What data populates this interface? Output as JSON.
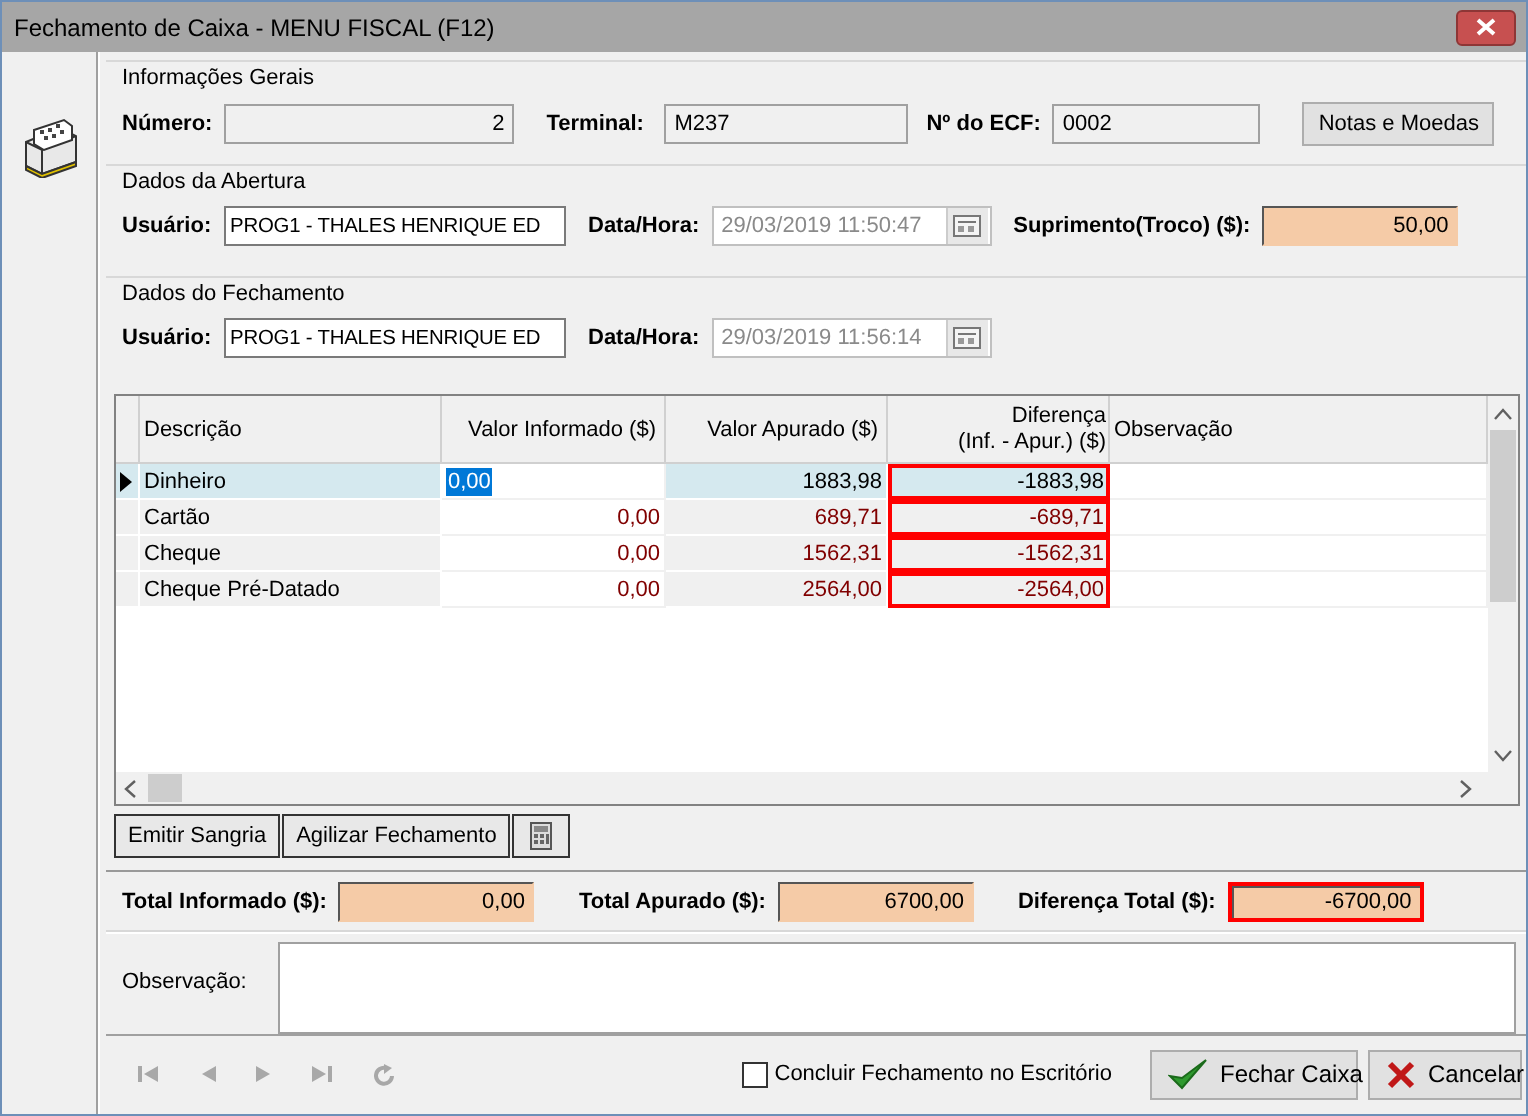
{
  "window": {
    "title": "Fechamento de Caixa - MENU FISCAL (F12)"
  },
  "general": {
    "legend": "Informações Gerais",
    "fields": [
      {
        "label": "Número:",
        "value": "2",
        "kind": "number"
      },
      {
        "label": "Terminal:",
        "value": "M237",
        "kind": "text"
      },
      {
        "label": "Nº do ECF:",
        "value": "0002",
        "kind": "text"
      }
    ],
    "button": "Notas e Moedas"
  },
  "opening": {
    "legend": "Dados da Abertura",
    "user": {
      "label": "Usuário:",
      "value": "PROG1 - THALES HENRIQUE ED"
    },
    "datetime": {
      "label": "Data/Hora:",
      "value": "29/03/2019 11:50:47",
      "disabled": true
    },
    "supply": {
      "label": "Suprimento(Troco) ($):",
      "value": "50,00"
    }
  },
  "closing": {
    "legend": "Dados do Fechamento",
    "user": {
      "label": "Usuário:",
      "value": "PROG1 - THALES HENRIQUE ED"
    },
    "datetime": {
      "label": "Data/Hora:",
      "value": "29/03/2019 11:56:14",
      "disabled": true
    }
  },
  "grid": {
    "columns": [
      "Descrição",
      "Valor Informado ($)",
      "Valor Apurado ($)",
      "Diferença\n(Inf. - Apur.) ($)",
      "Observação"
    ],
    "rows": [
      {
        "description": "Dinheiro",
        "informed": "0,00",
        "computed": "1883,98",
        "difference": "-1883,98",
        "selected": true,
        "flagged": true
      },
      {
        "description": "Cartão",
        "informed": "0,00",
        "computed": "689,71",
        "difference": "-689,71",
        "selected": false,
        "flagged": true
      },
      {
        "description": "Cheque",
        "informed": "0,00",
        "computed": "1562,31",
        "difference": "-1562,31",
        "selected": false,
        "flagged": true
      },
      {
        "description": "Cheque Pré-Datado",
        "informed": "0,00",
        "computed": "2564,00",
        "difference": "-2564,00",
        "selected": false,
        "flagged": true
      }
    ]
  },
  "actions": [
    "Emitir Sangria",
    "Agilizar Fechamento"
  ],
  "totals": [
    {
      "label": "Total Informado ($):",
      "value": "0,00",
      "flagged": false
    },
    {
      "label": "Total Apurado ($):",
      "value": "6700,00",
      "flagged": false
    },
    {
      "label": "Diferença Total ($):",
      "value": "-6700,00",
      "flagged": true
    }
  ],
  "observation": {
    "label": "Observação:"
  },
  "footer": {
    "checkbox": {
      "label": "Concluir Fechamento no Escritório",
      "checked": false
    },
    "buttons": [
      {
        "label": "Fechar Caixa",
        "kind": "confirm"
      },
      {
        "label": "Cancelar",
        "kind": "cancel"
      }
    ]
  }
}
